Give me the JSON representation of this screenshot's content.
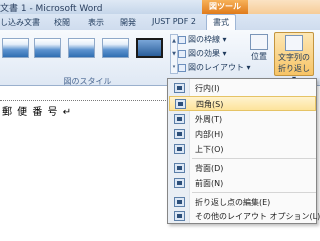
{
  "window": {
    "title": "文書 1 - Microsoft Word",
    "contextual_tab_group": "図ツール",
    "accent_color": "#f0962f"
  },
  "tabs": [
    {
      "label": "し込み文書"
    },
    {
      "label": "校閲"
    },
    {
      "label": "表示"
    },
    {
      "label": "開発"
    },
    {
      "label": "JUST PDF 2"
    },
    {
      "label": "書式",
      "active": true
    }
  ],
  "ribbon": {
    "picture_styles_group_label": "図のスタイル",
    "commands": {
      "border": "図の枠線 ▾",
      "effects": "図の効果 ▾",
      "layout": "図のレイアウト ▾"
    },
    "position_label": "位置",
    "text_wrap_label_1": "文字列の",
    "text_wrap_label_2": "折り返し ▾"
  },
  "document": {
    "text": "郵 便 番 号 ↵"
  },
  "wrap_menu": {
    "items": [
      {
        "label": "行内(I)",
        "hover": false
      },
      {
        "label": "四角(S)",
        "hover": true
      },
      {
        "label": "外周(T)",
        "hover": false
      },
      {
        "label": "内部(H)",
        "hover": false
      },
      {
        "label": "上下(O)",
        "hover": false
      },
      {
        "label": "背面(D)",
        "hover": false
      },
      {
        "label": "前面(N)",
        "hover": false
      },
      {
        "label": "折り返し点の編集(E)",
        "hover": false
      },
      {
        "label": "その他のレイアウト オプション(L)...",
        "hover": false
      }
    ]
  }
}
